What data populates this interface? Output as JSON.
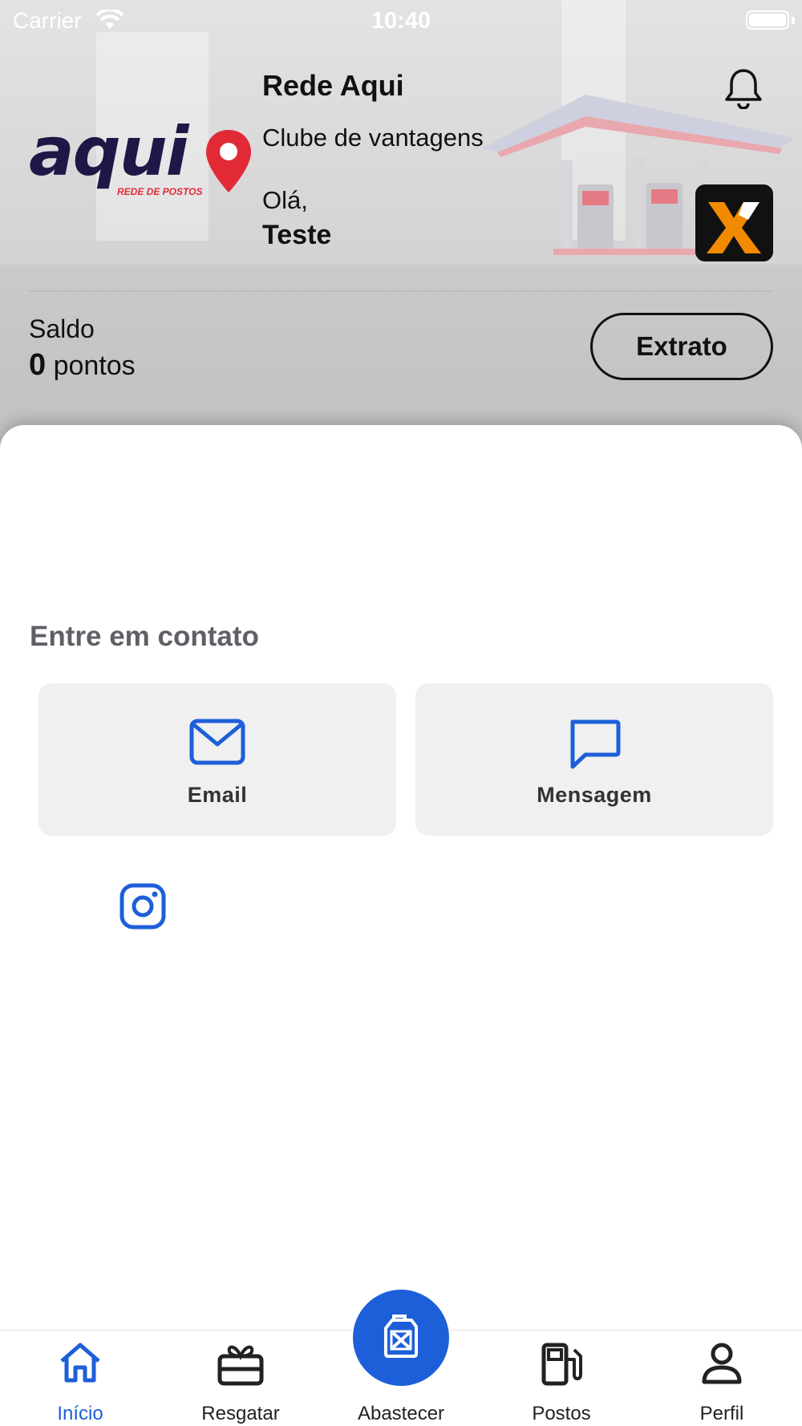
{
  "status_bar": {
    "carrier": "Carrier",
    "time": "10:40"
  },
  "header": {
    "brand_logo_text": "aqui",
    "brand_logo_subtext": "REDE DE POSTOS",
    "title": "Rede Aqui",
    "subtitle": "Clube de vantagens",
    "greeting": "Olá,",
    "username": "Teste"
  },
  "balance": {
    "label": "Saldo",
    "value": "0",
    "unit": "pontos",
    "statement_button": "Extrato"
  },
  "contact": {
    "title": "Entre em contato",
    "items": [
      {
        "label": "Email",
        "icon": "mail-icon"
      },
      {
        "label": "Mensagem",
        "icon": "message-icon"
      }
    ],
    "social_icon": "instagram-icon"
  },
  "tabbar": {
    "items": [
      {
        "label": "Início",
        "icon": "home-icon",
        "active": true
      },
      {
        "label": "Resgatar",
        "icon": "gift-icon",
        "active": false
      },
      {
        "label": "Abastecer",
        "icon": "fuel-can-icon",
        "active": false
      },
      {
        "label": "Postos",
        "icon": "gas-station-icon",
        "active": false
      },
      {
        "label": "Perfil",
        "icon": "user-icon",
        "active": false
      }
    ]
  },
  "colors": {
    "accent": "#1d5fd8",
    "brand_dark": "#1e1846",
    "brand_red": "#e12a36",
    "partner_orange": "#f28a00"
  }
}
